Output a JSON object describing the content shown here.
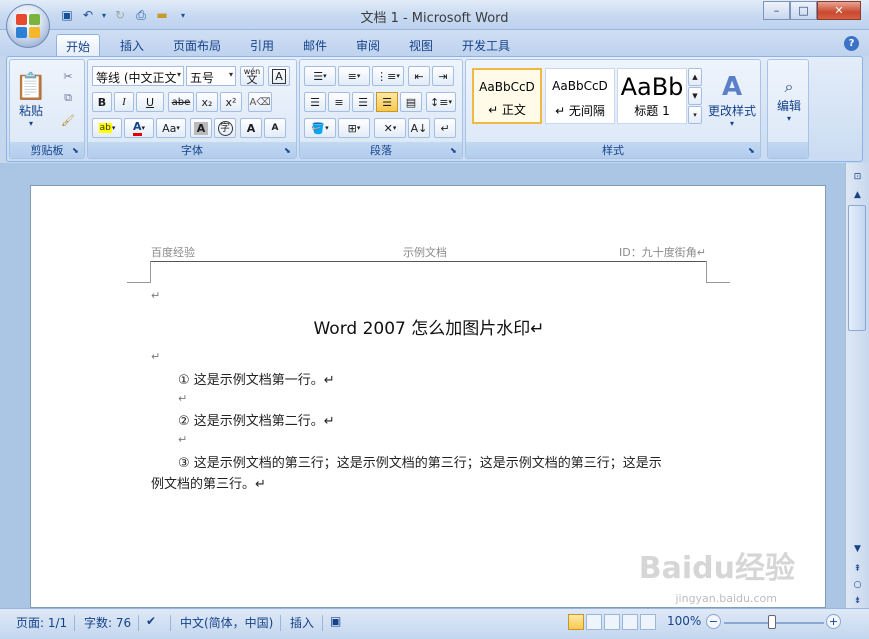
{
  "window": {
    "title": "文档 1 - Microsoft Word",
    "controls": {
      "minimize": "–",
      "maximize": "□",
      "close": "✕"
    }
  },
  "tabs": [
    {
      "label": "开始",
      "active": true
    },
    {
      "label": "插入"
    },
    {
      "label": "页面布局"
    },
    {
      "label": "引用"
    },
    {
      "label": "邮件"
    },
    {
      "label": "审阅"
    },
    {
      "label": "视图"
    },
    {
      "label": "开发工具"
    }
  ],
  "ribbon": {
    "clipboard": {
      "label": "剪贴板",
      "paste": "粘贴"
    },
    "font": {
      "label": "字体",
      "font_name": "等线 (中文正文",
      "font_size": "五号",
      "wen": "wén\n文",
      "bold": "B",
      "italic": "I",
      "underline": "U",
      "strike": "abe",
      "sub": "x₂",
      "sup": "x²",
      "aa": "Aa",
      "grow": "A",
      "shrink": "A"
    },
    "paragraph": {
      "label": "段落"
    },
    "styles": {
      "label": "样式",
      "items": [
        {
          "sample": "AaBbCcD",
          "name": "↵ 正文",
          "selected": true
        },
        {
          "sample": "AaBbCcD",
          "name": "↵ 无间隔"
        },
        {
          "sample": "AaBb",
          "name": "标题 1"
        }
      ],
      "change_styles": "更改样式"
    },
    "editing": {
      "label": "编辑"
    }
  },
  "document": {
    "header_left": "百度经验",
    "header_center": "示例文档",
    "header_right": "ID：九十度街角↵",
    "title": "Word 2007 怎么加图片水印↵",
    "line1": "① 这是示例文档第一行。↵",
    "line2": "② 这是示例文档第二行。↵",
    "line3a": "③ 这是示例文档的第三行；这是示例文档的第三行；这是示例文档的第三行；这是示",
    "line3b": "例文档的第三行。↵",
    "para_mark": "↵"
  },
  "watermark": {
    "text": "Baidu经验",
    "sub": "jingyan.baidu.com"
  },
  "status": {
    "page": "页面: 1/1",
    "words": "字数: 76",
    "language": "中文(简体，中国)",
    "mode": "插入",
    "zoom": "100%"
  },
  "colors": {
    "ribbon_bg": "#d2e1f4",
    "accent": "#15428b",
    "highlight": "#f9c84c"
  }
}
